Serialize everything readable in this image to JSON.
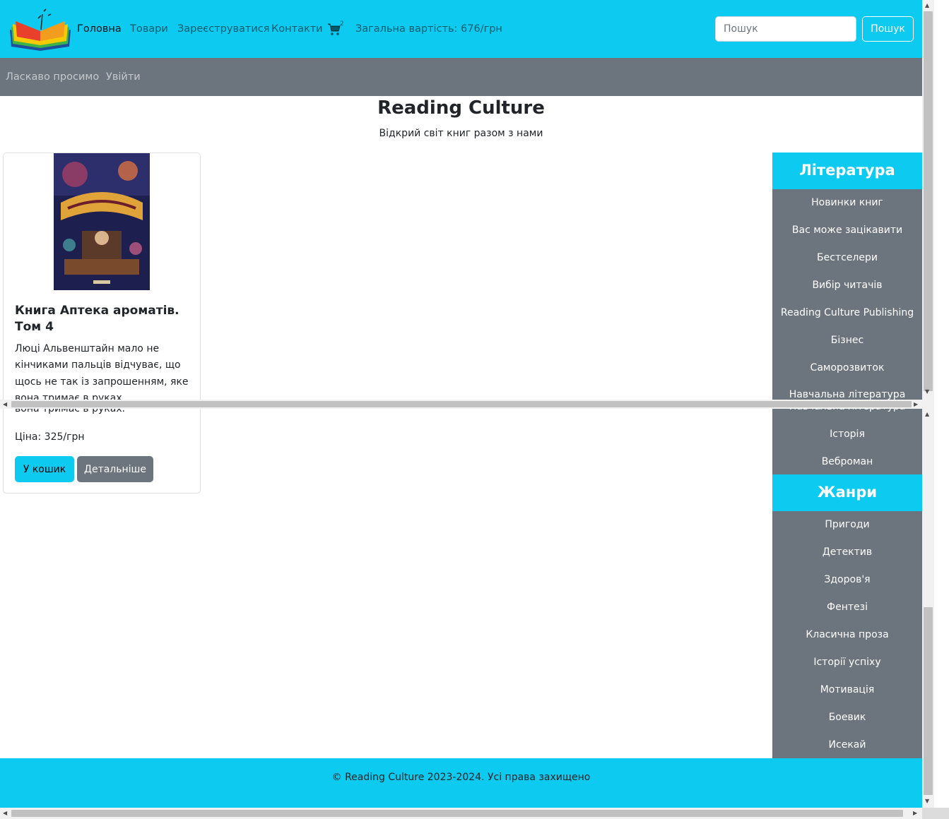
{
  "navbar": {
    "logo_icon": "open-book-logo",
    "links": [
      {
        "label": "Головна",
        "active": true
      },
      {
        "label": "Товари"
      },
      {
        "label": "Зареєструватися"
      },
      {
        "label": "Контакти"
      }
    ],
    "cart_icon": "shopping-cart-icon",
    "cart_count": "2",
    "total": "Загальна вартість: 676/грн",
    "search_placeholder": "Пошук",
    "search_button": "Пошук",
    "bg_color": "#0dcaf0"
  },
  "subbar": {
    "welcome": "Ласкаво просимо",
    "login": "Увійти",
    "bg_color": "#6c757d"
  },
  "hero": {
    "title": "Reading Culture",
    "subtitle": "Відкрий світ книг разом з нами"
  },
  "product": {
    "title": "Книга Аптека ароматів. Том 4",
    "description": "Люці Альвенштайн мало не кінчиками пальців відчуває, що щось не так із запрошенням, яке вона тримає в руках.",
    "description_tail": "вона тримає в руках.",
    "price": "Ціна: 325/грн",
    "add_to_cart": "У кошик",
    "details": "Детальніше"
  },
  "sidebar": {
    "literature_title": "Література",
    "literature_items": [
      "Новинки книг",
      "Вас може зацікавити",
      "Бестселери",
      "Вибір читачів",
      "Reading Culture Publishing",
      "Бізнес",
      "Саморозвиток",
      "Навчальна література",
      "Навчальна література",
      "Історія",
      "Веброман"
    ],
    "genres_title": "Жанри",
    "genre_items": [
      "Пригоди",
      "Детектив",
      "Здоров'я",
      "Фентезі",
      "Класична проза",
      "Історії успіху",
      "Мотивація",
      "Боевик",
      "Исекай"
    ]
  },
  "footer": {
    "text": "© Reading Culture 2023-2024. Усі права захищено"
  }
}
